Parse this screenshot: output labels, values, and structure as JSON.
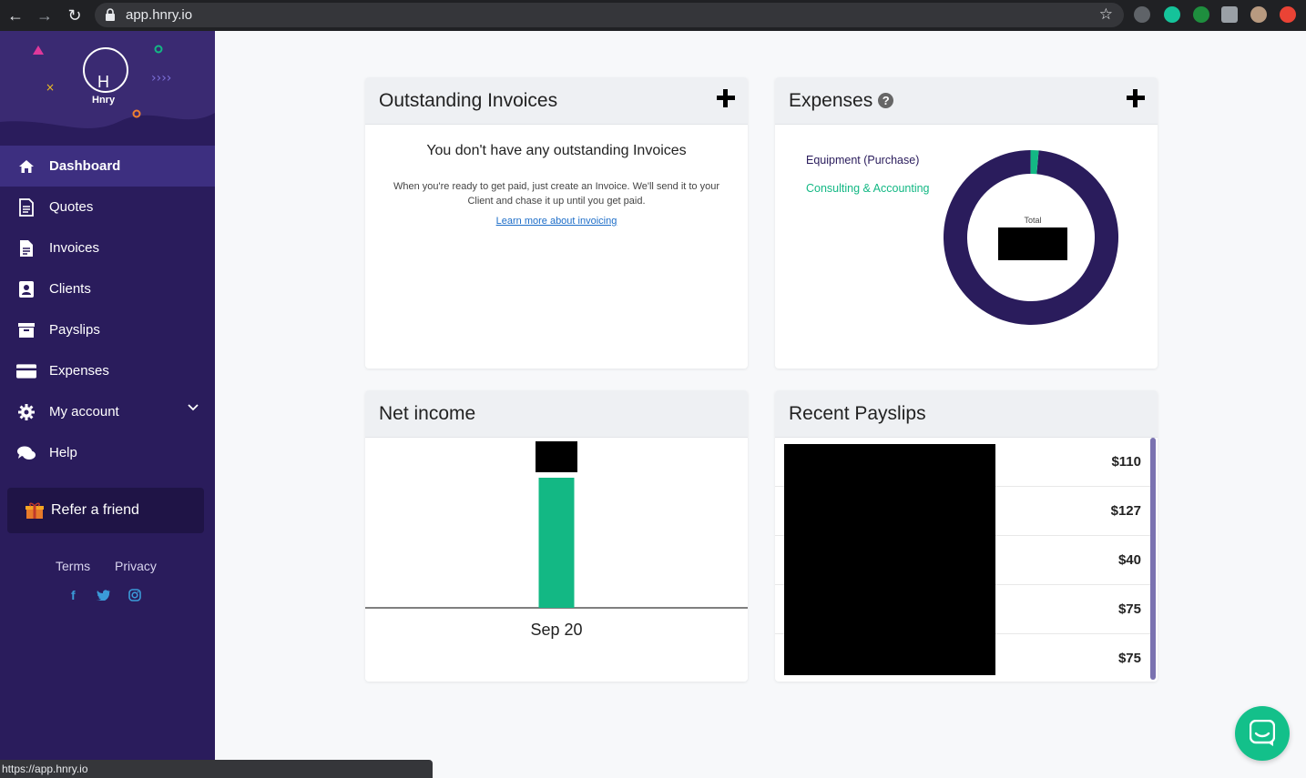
{
  "browser": {
    "url": "app.hnry.io",
    "status_url": "https://app.hnry.io"
  },
  "brand": {
    "logo_text": "Hnry",
    "logo_letter": "H"
  },
  "sidebar": {
    "items": [
      {
        "label": "Dashboard",
        "icon": "home-icon",
        "active": true
      },
      {
        "label": "Quotes",
        "icon": "document-icon"
      },
      {
        "label": "Invoices",
        "icon": "invoice-icon"
      },
      {
        "label": "Clients",
        "icon": "client-icon"
      },
      {
        "label": "Payslips",
        "icon": "archive-icon"
      },
      {
        "label": "Expenses",
        "icon": "credit-card-icon"
      },
      {
        "label": "My account",
        "icon": "gear-icon"
      },
      {
        "label": "Help",
        "icon": "chat-icon"
      }
    ],
    "refer_label": "Refer a friend",
    "terms_label": "Terms",
    "privacy_label": "Privacy"
  },
  "invoices": {
    "title": "Outstanding Invoices",
    "empty_title": "You don't have any outstanding Invoices",
    "empty_desc": "When you're ready to get paid, just create an Invoice. We'll send it to your Client and chase it up until you get paid.",
    "link": "Learn more about invoicing"
  },
  "expenses": {
    "title": "Expenses",
    "help_glyph": "?",
    "total_label": "Total",
    "legend": [
      {
        "label": "Equipment (Purchase)",
        "color": "#2a1c5c"
      },
      {
        "label": "Consulting & Accounting",
        "color": "#13b884"
      }
    ]
  },
  "net_income": {
    "title": "Net income"
  },
  "payslips": {
    "title": "Recent Payslips",
    "amounts": [
      "$110",
      "$127",
      "$40",
      "$75",
      "$75"
    ]
  },
  "chart_data": [
    {
      "type": "pie",
      "categories": [
        "Equipment (Purchase)",
        "Consulting & Accounting"
      ],
      "values": [
        98.5,
        1.5
      ],
      "donut": true,
      "center_label": "Total"
    },
    {
      "type": "bar",
      "categories": [
        "Sep 20"
      ],
      "values": [
        1
      ],
      "xlabel": "",
      "ylabel": ""
    }
  ],
  "colors": {
    "sidebar": "#2a1c5c",
    "accent": "#13b884",
    "active": "#3d2f80"
  }
}
